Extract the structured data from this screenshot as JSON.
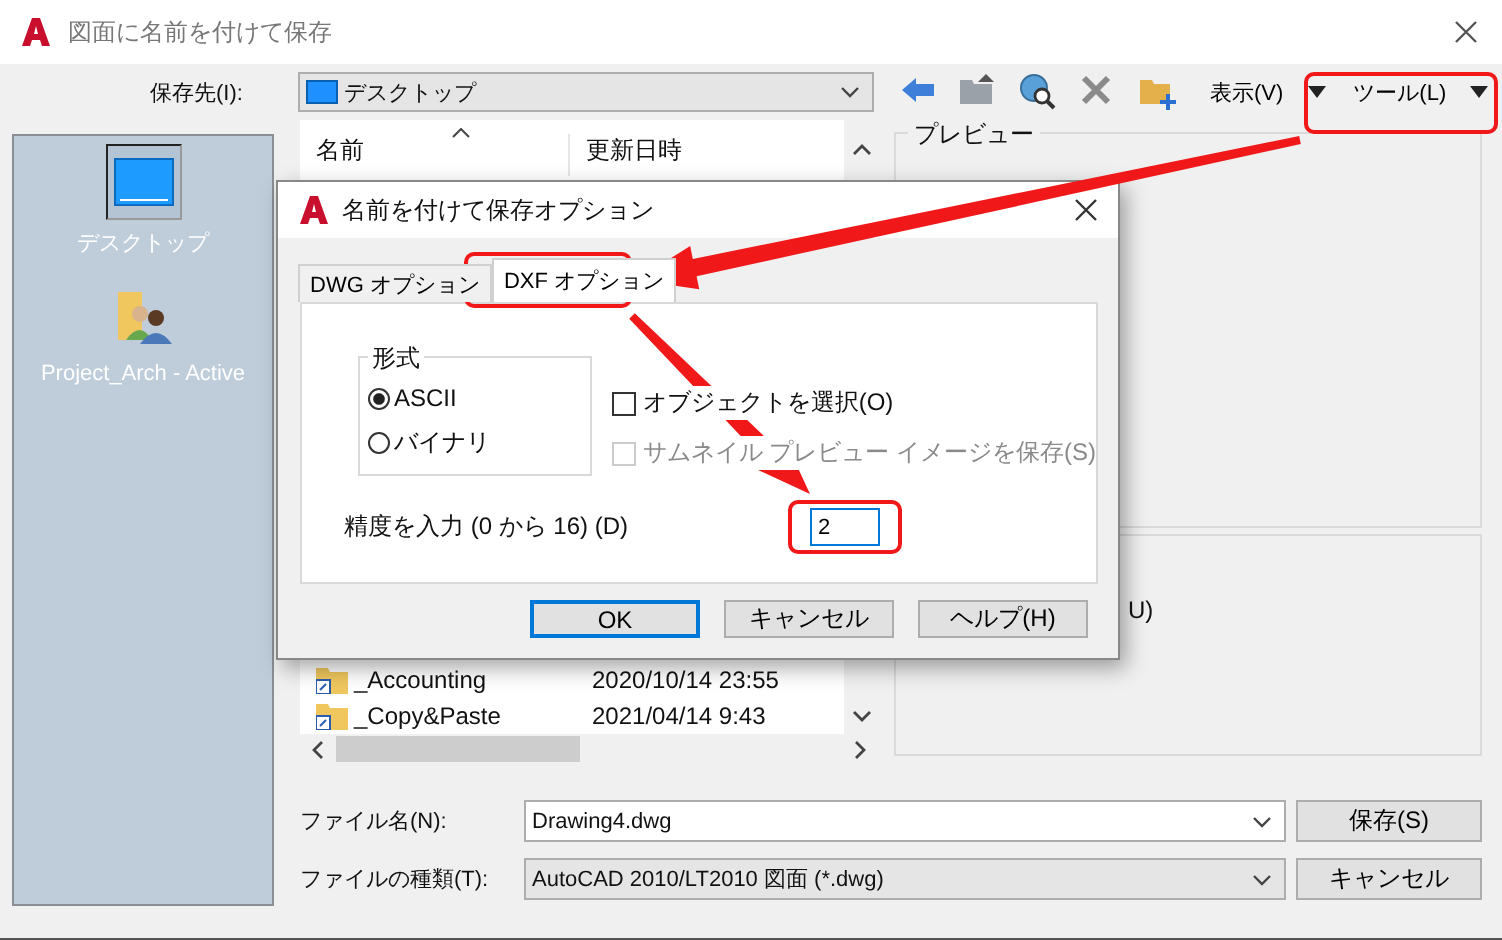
{
  "window": {
    "title": "図面に名前を付けて保存"
  },
  "save_in": {
    "label": "保存先(I):",
    "value": "デスクトップ"
  },
  "toolbar": {
    "view_menu": "表示(V)",
    "tools_menu": "ツール(L)"
  },
  "sidebar": {
    "items": [
      {
        "label": "デスクトップ",
        "selected": true,
        "kind": "desktop"
      },
      {
        "label": "Project_Arch - Active",
        "selected": false,
        "kind": "shared-folder"
      }
    ]
  },
  "file_list": {
    "columns": [
      "名前",
      "更新日時"
    ],
    "rows": [
      {
        "name": "_Accounting",
        "modified": "2020/10/14 23:55"
      },
      {
        "name": "_Copy&Paste",
        "modified": "2021/04/14 9:43"
      }
    ]
  },
  "preview": {
    "title": "プレビュー",
    "option_tail": "U)"
  },
  "file_name": {
    "label": "ファイル名(N):",
    "value": "Drawing4.dwg"
  },
  "file_type": {
    "label": "ファイルの種類(T):",
    "value": "AutoCAD 2010/LT2010 図面 (*.dwg)"
  },
  "buttons": [
    "保存(S)",
    "キャンセル"
  ],
  "dialog": {
    "title": "名前を付けて保存オプション",
    "tabs": [
      {
        "label": "DWG オプション",
        "selected": false
      },
      {
        "label": "DXF オプション",
        "selected": true
      }
    ],
    "format": {
      "title": "形式",
      "options": [
        {
          "label": "ASCII",
          "selected": true
        },
        {
          "label": "バイナリ",
          "selected": false
        }
      ]
    },
    "checkboxes": [
      {
        "label": "オブジェクトを選択(O)",
        "checked": false,
        "disabled": false
      },
      {
        "label": "サムネイル プレビュー イメージを保存(S)",
        "checked": false,
        "disabled": true
      }
    ],
    "precision": {
      "label": "精度を入力 (0 から 16) (D)",
      "value": "2"
    },
    "buttons": [
      {
        "label": "OK",
        "default": true
      },
      {
        "label": "キャンセル",
        "default": false
      },
      {
        "label": "ヘルプ(H)",
        "default": false
      }
    ]
  }
}
